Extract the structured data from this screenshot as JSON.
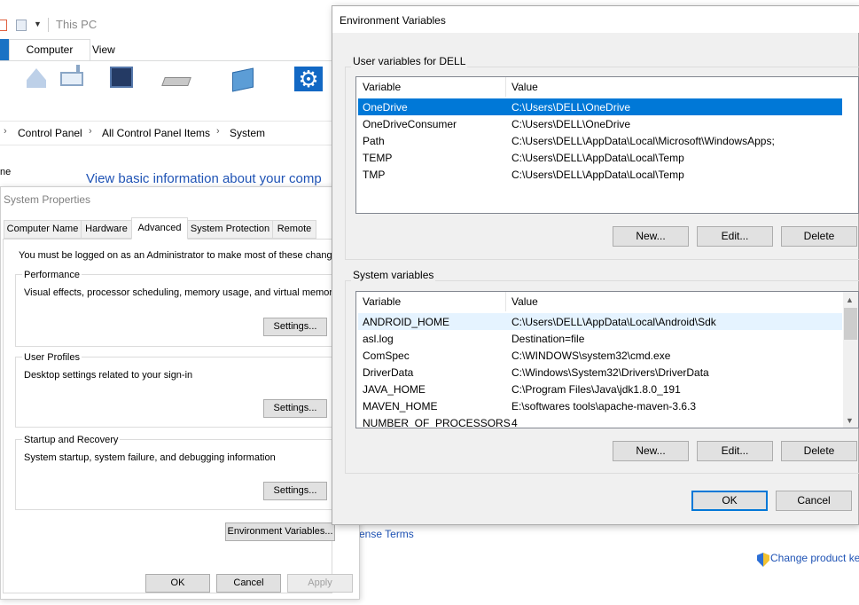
{
  "explorer": {
    "title": "This PC",
    "tabs": [
      "Computer",
      "View"
    ],
    "breadcrumb": [
      "Control Panel",
      "All Control Panel Items",
      "System"
    ],
    "side_text": "ne",
    "heading": "View basic information about your comp",
    "license_link": "ense Terms",
    "change_key_link": "Change product ke"
  },
  "system_properties": {
    "title": "System Properties",
    "tabs": [
      "Computer Name",
      "Hardware",
      "Advanced",
      "System Protection",
      "Remote"
    ],
    "active_tab": "Advanced",
    "admin_note": "You must be logged on as an Administrator to make most of these changes.",
    "performance": {
      "label": "Performance",
      "desc": "Visual effects, processor scheduling, memory usage, and virtual memory",
      "button": "Settings..."
    },
    "user_profiles": {
      "label": "User Profiles",
      "desc": "Desktop settings related to your sign-in",
      "button": "Settings..."
    },
    "startup": {
      "label": "Startup and Recovery",
      "desc": "System startup, system failure, and debugging information",
      "button": "Settings..."
    },
    "env_button": "Environment Variables...",
    "ok": "OK",
    "cancel": "Cancel",
    "apply": "Apply"
  },
  "env_vars": {
    "title": "Environment Variables",
    "user_section": "User variables for DELL",
    "system_section": "System variables",
    "col_variable": "Variable",
    "col_value": "Value",
    "user_vars": [
      {
        "name": "OneDrive",
        "value": "C:\\Users\\DELL\\OneDrive"
      },
      {
        "name": "OneDriveConsumer",
        "value": "C:\\Users\\DELL\\OneDrive"
      },
      {
        "name": "Path",
        "value": "C:\\Users\\DELL\\AppData\\Local\\Microsoft\\WindowsApps;"
      },
      {
        "name": "TEMP",
        "value": "C:\\Users\\DELL\\AppData\\Local\\Temp"
      },
      {
        "name": "TMP",
        "value": "C:\\Users\\DELL\\AppData\\Local\\Temp"
      }
    ],
    "system_vars": [
      {
        "name": "ANDROID_HOME",
        "value": "C:\\Users\\DELL\\AppData\\Local\\Android\\Sdk"
      },
      {
        "name": "asl.log",
        "value": "Destination=file"
      },
      {
        "name": "ComSpec",
        "value": "C:\\WINDOWS\\system32\\cmd.exe"
      },
      {
        "name": "DriverData",
        "value": "C:\\Windows\\System32\\Drivers\\DriverData"
      },
      {
        "name": "JAVA_HOME",
        "value": "C:\\Program Files\\Java\\jdk1.8.0_191"
      },
      {
        "name": "MAVEN_HOME",
        "value": "E:\\softwares tools\\apache-maven-3.6.3"
      },
      {
        "name": "NUMBER_OF_PROCESSORS",
        "value": "4"
      }
    ],
    "user_buttons": {
      "new": "New...",
      "edit": "Edit...",
      "delete": "Delete"
    },
    "system_buttons": {
      "new": "New...",
      "edit": "Edit...",
      "delete": "Delete"
    },
    "ok": "OK",
    "cancel": "Cancel"
  }
}
